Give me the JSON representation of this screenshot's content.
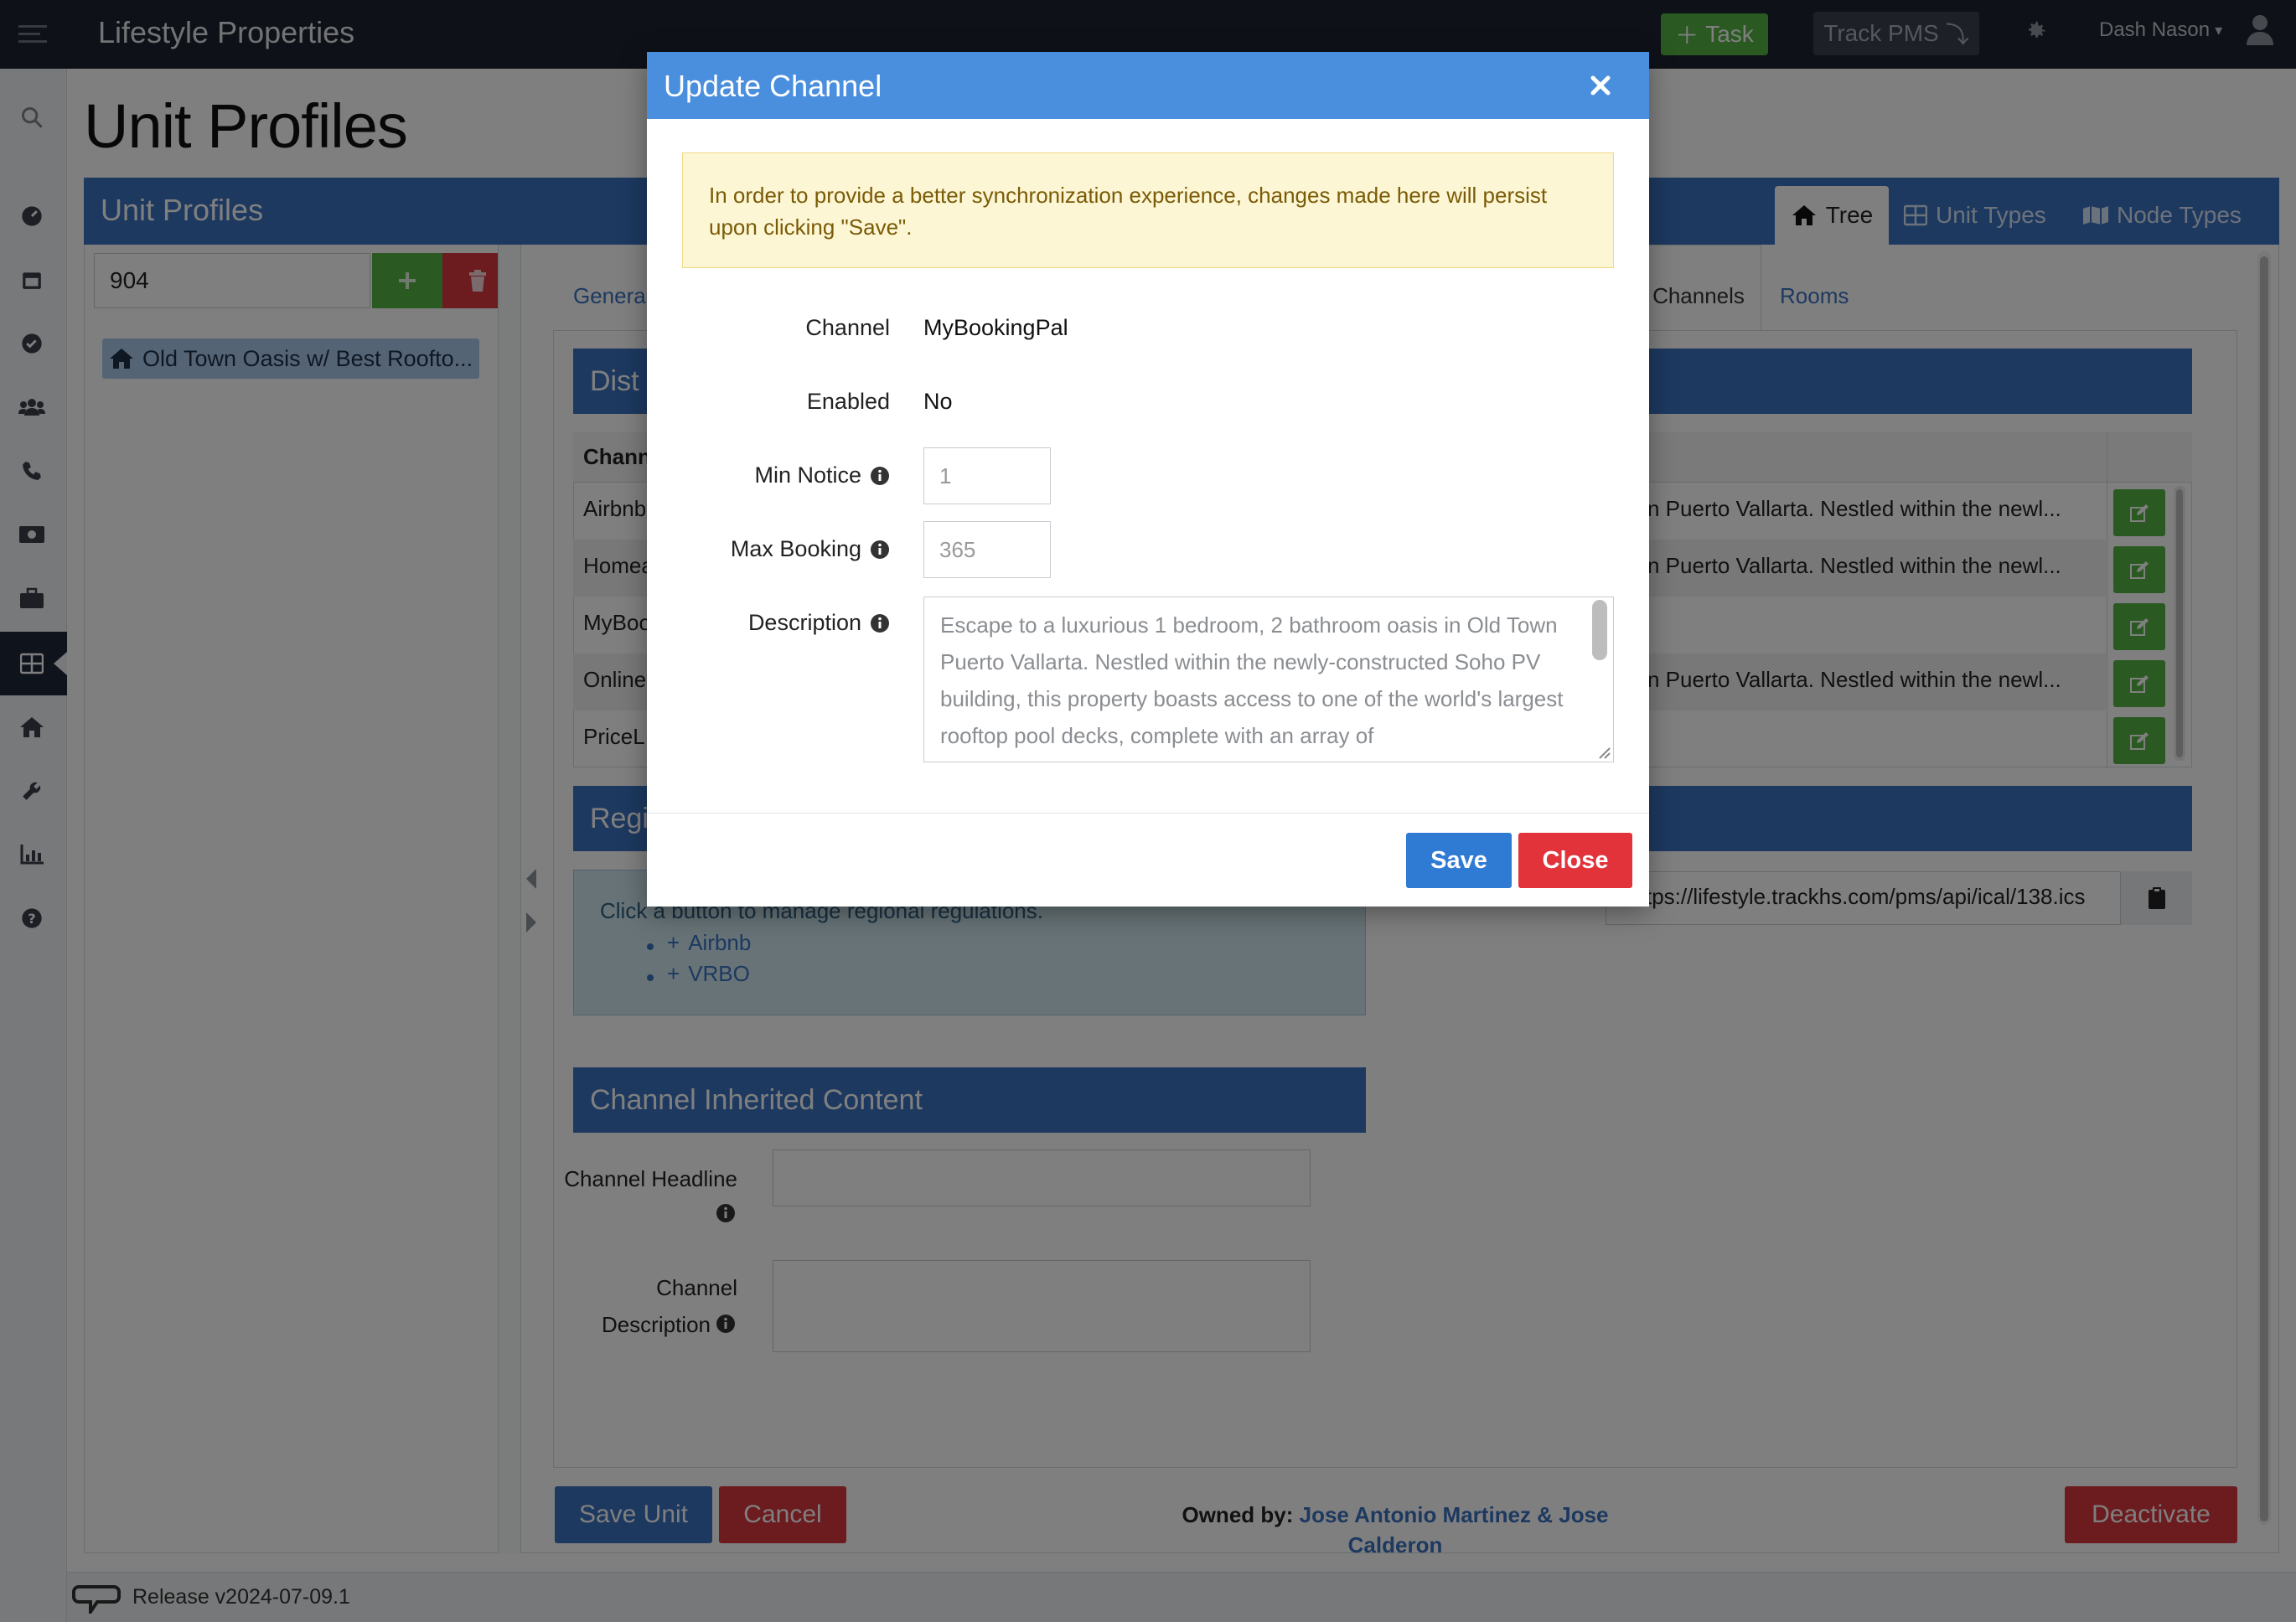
{
  "header": {
    "app_title": "Lifestyle Properties",
    "task_label": "Task",
    "trackpms_label": "Track PMS",
    "user_name": "Dash Nason"
  },
  "page": {
    "title": "Unit Profiles",
    "panel_title": "Unit Profiles",
    "view_tabs": [
      "Tree",
      "Unit Types",
      "Node Types"
    ]
  },
  "tree": {
    "search_value": "904",
    "node_label": "Old Town Oasis w/ Best Roofto..."
  },
  "unit_tabs": {
    "general": "Genera",
    "channels": "Channels",
    "rooms": "Rooms"
  },
  "distribution": {
    "header": "Dist",
    "col_channel": "Chann",
    "rows": [
      {
        "name": "Airbnb",
        "desc": "n Puerto Vallarta. Nestled within the newl..."
      },
      {
        "name": "Homea",
        "desc": "n Puerto Vallarta. Nestled within the newl..."
      },
      {
        "name": "MyBoo",
        "desc": ""
      },
      {
        "name": "Online",
        "desc": "n Puerto Vallarta. Nestled within the newl..."
      },
      {
        "name": "PriceL",
        "desc": ""
      }
    ]
  },
  "regulations": {
    "header": "Regi",
    "hint": "Click a button to manage regional regulations.",
    "links": [
      "Airbnb",
      "VRBO"
    ],
    "ical_url": "tps://lifestyle.trackhs.com/pms/api/ical/138.ics"
  },
  "inherited": {
    "header": "Channel Inherited Content",
    "headline_label": "Channel Headline",
    "description_label_1": "Channel",
    "description_label_2": "Description"
  },
  "actions": {
    "save_unit": "Save Unit",
    "cancel": "Cancel",
    "owned_by_label": "Owned by:",
    "owner_name": "Jose Antonio Martinez & Jose Calderon",
    "deactivate": "Deactivate"
  },
  "footer": {
    "release": "Release v2024-07-09.1"
  },
  "modal": {
    "title": "Update Channel",
    "alert": "In order to provide a better synchronization experience, changes made here will persist upon clicking \"Save\".",
    "channel_label": "Channel",
    "channel_value": "MyBookingPal",
    "enabled_label": "Enabled",
    "enabled_value": "No",
    "min_notice_label": "Min Notice",
    "min_notice_placeholder": "1",
    "max_booking_label": "Max Booking",
    "max_booking_placeholder": "365",
    "description_label": "Description",
    "description_placeholder": "Escape to a luxurious 1 bedroom, 2 bathroom oasis in Old Town Puerto Vallarta. Nestled within the newly-constructed Soho PV building, this property boasts access to one of the world's largest rooftop pool decks, complete with an array of",
    "save_label": "Save",
    "close_label": "Close"
  },
  "colors": {
    "brand_blue": "#3b72c0",
    "modal_header": "#4a8fde",
    "success": "#55b345",
    "danger": "#d9363e",
    "topbar": "#1d2331"
  }
}
